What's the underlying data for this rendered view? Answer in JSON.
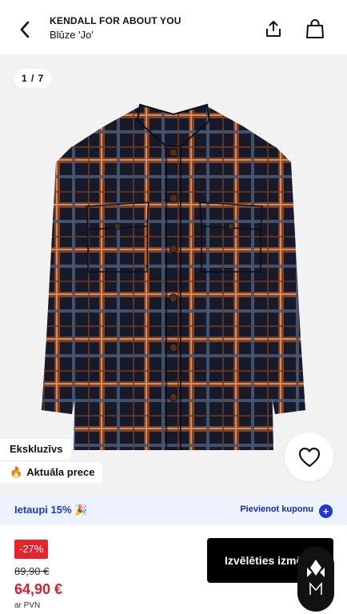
{
  "header": {
    "brand": "KENDALL FOR ABOUT YOU",
    "product_name": "Blūze 'Jo'",
    "back_icon": "chevron-left-icon",
    "share_icon": "share-icon",
    "bag_icon": "bag-icon"
  },
  "gallery": {
    "counter": "1 / 7",
    "tags": [
      {
        "label": "Ekskluzīvs"
      },
      {
        "label": "Aktuāla prece",
        "icon": "fire-icon"
      }
    ],
    "favorite_icon": "heart-icon"
  },
  "promo": {
    "left_text": "Ietaupi 15% 🎉",
    "right_text": "Pievienot kuponu",
    "plus": "+"
  },
  "pricing": {
    "discount": "-27%",
    "old_price": "89,90 €",
    "new_price": "64,90 €",
    "vat_note": "ar PVN"
  },
  "cta": {
    "label": "Izvēlēties izmēru"
  },
  "colors": {
    "accent_blue": "#2334d9",
    "sale_red": "#e8232d",
    "promo_bg": "#edf2ff"
  }
}
